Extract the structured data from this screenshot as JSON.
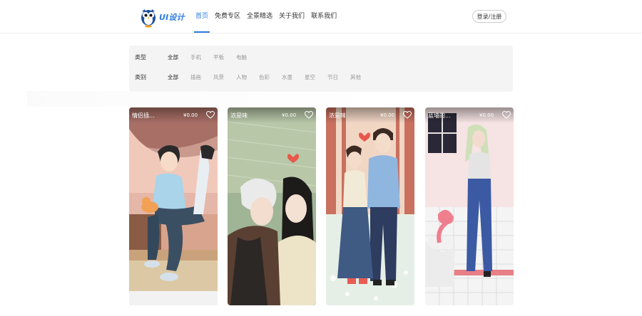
{
  "header": {
    "logo_text": "UI设计",
    "nav": [
      "首页",
      "免费专区",
      "全景精选",
      "关于我们",
      "联系我们"
    ],
    "nav_active_index": 0,
    "login_label": "登录/注册",
    "accent_color": "#2b7ce0"
  },
  "filters": {
    "row1": {
      "label": "类型",
      "options": [
        "全部",
        "手机",
        "平板",
        "电脑"
      ],
      "selected_index": 0
    },
    "row2": {
      "label": "类别",
      "options": [
        "全部",
        "插画",
        "风景",
        "人物",
        "色彩",
        "水墨",
        "星空",
        "节日",
        "其他"
      ],
      "selected_index": 0
    }
  },
  "cards": [
    {
      "title": "情侣插...",
      "price": "¥0.00",
      "icon": "heart-outline-icon"
    },
    {
      "title": "浓是味",
      "price": "¥0.00",
      "icon": "heart-outline-icon"
    },
    {
      "title": "浓是味",
      "price": "¥0.00",
      "icon": "heart-outline-icon"
    },
    {
      "title": "蓝墙的...",
      "price": "¥0.00",
      "icon": "heart-outline-icon"
    }
  ]
}
